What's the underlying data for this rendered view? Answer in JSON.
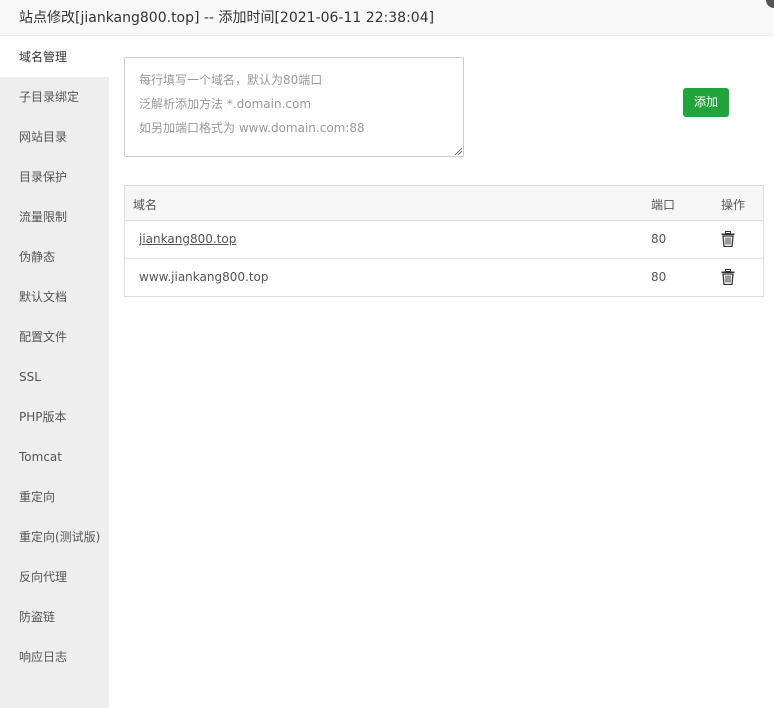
{
  "titlebar": {
    "title": "站点修改[jiankang800.top] -- 添加时间[2021-06-11 22:38:04]"
  },
  "sidebar": {
    "items": [
      {
        "label": "域名管理",
        "active": true
      },
      {
        "label": "子目录绑定"
      },
      {
        "label": "网站目录"
      },
      {
        "label": "目录保护"
      },
      {
        "label": "流量限制"
      },
      {
        "label": "伪静态"
      },
      {
        "label": "默认文档"
      },
      {
        "label": "配置文件"
      },
      {
        "label": "SSL"
      },
      {
        "label": "PHP版本"
      },
      {
        "label": "Tomcat"
      },
      {
        "label": "重定向"
      },
      {
        "label": "重定向(测试版)"
      },
      {
        "label": "反向代理"
      },
      {
        "label": "防盗链"
      },
      {
        "label": "响应日志"
      }
    ]
  },
  "domain_input": {
    "placeholder_lines": [
      "每行填写一个域名，默认为80端口",
      "泛解析添加方法 *.domain.com",
      "如另加端口格式为 www.domain.com:88"
    ],
    "value": ""
  },
  "add_button": {
    "label": "添加",
    "color": "#20a53a"
  },
  "table": {
    "headers": {
      "domain": "域名",
      "port": "端口",
      "action": "操作"
    },
    "rows": [
      {
        "domain": "jiankang800.top",
        "port": "80",
        "action_icon": "trash-icon"
      },
      {
        "domain": "www.jiankang800.top",
        "port": "80",
        "action_icon": "trash-icon"
      }
    ]
  }
}
